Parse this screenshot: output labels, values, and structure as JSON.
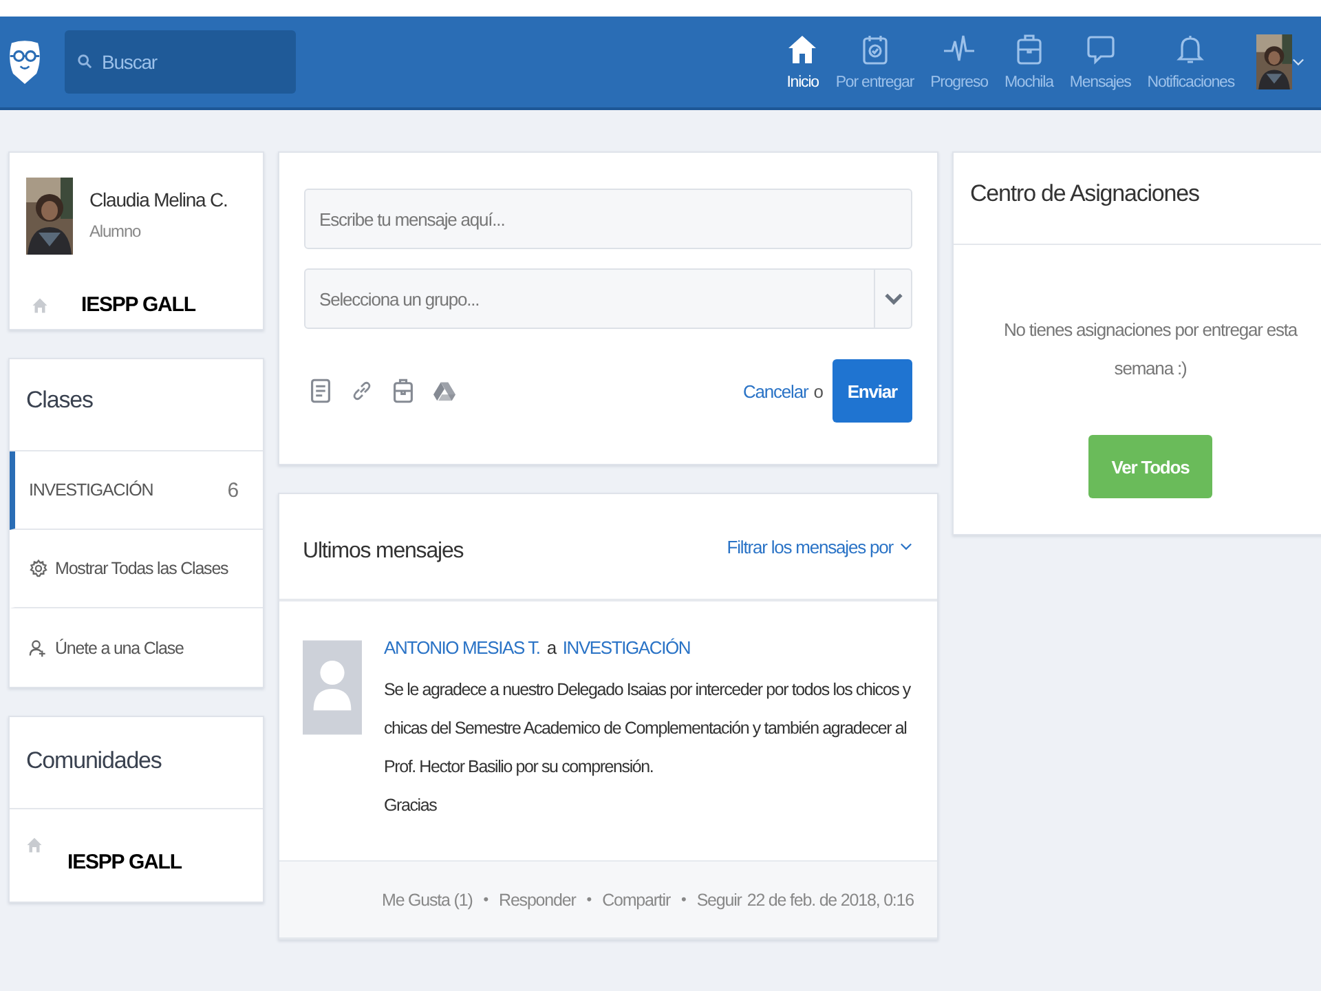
{
  "navbar": {
    "search": {
      "placeholder": "Buscar"
    },
    "items": [
      {
        "label": "Inicio",
        "selected": true
      },
      {
        "label": "Por entregar",
        "selected": false
      },
      {
        "label": "Progreso",
        "selected": false
      },
      {
        "label": "Mochila",
        "selected": false
      },
      {
        "label": "Mensajes",
        "selected": false
      },
      {
        "label": "Notificaciones",
        "selected": false
      }
    ]
  },
  "profile": {
    "name": "Claudia Melina C.",
    "role": "Alumno",
    "school": "IESPP GALL"
  },
  "classes": {
    "title": "Clases",
    "items": [
      {
        "kind": "class",
        "label": "INVESTIGACIÓN",
        "count": "6",
        "selected": true
      },
      {
        "kind": "show-all",
        "label": "Mostrar Todas las Clases",
        "selected": false
      },
      {
        "kind": "join",
        "label": "Únete a una Clase",
        "selected": false
      }
    ]
  },
  "communities": {
    "title": "Comunidades",
    "items": [
      "IESPP GALL"
    ]
  },
  "composer": {
    "message_placeholder": "Escribe tu mensaje aquí...",
    "group_placeholder": "Selecciona un grupo...",
    "cancel": "Cancelar",
    "or": "o",
    "send": "Enviar"
  },
  "feed": {
    "title": "Ultimos mensajes",
    "filter": "Filtrar los mensajes por",
    "posts": [
      {
        "author": "ANTONIO MESIAS T.",
        "connector": "a",
        "group": "INVESTIGACIÓN",
        "body": "Se le agradece a nuestro Delegado Isaias por interceder por todos los chicos y chicas del Semestre Academico de Complementación y también agradecer al Prof. Hector Basilio por su comprensión.",
        "closing": "Gracias",
        "actions": [
          "Me Gusta (1)",
          "Responder",
          "Compartir",
          "Seguir"
        ],
        "separator": "•",
        "time": "22 de feb. de 2018, 0:16"
      }
    ]
  },
  "assignments": {
    "title": "Centro de Asignaciones",
    "empty": "No tienes asignaciones por entregar esta semana :)",
    "button": "Ver Todos"
  }
}
